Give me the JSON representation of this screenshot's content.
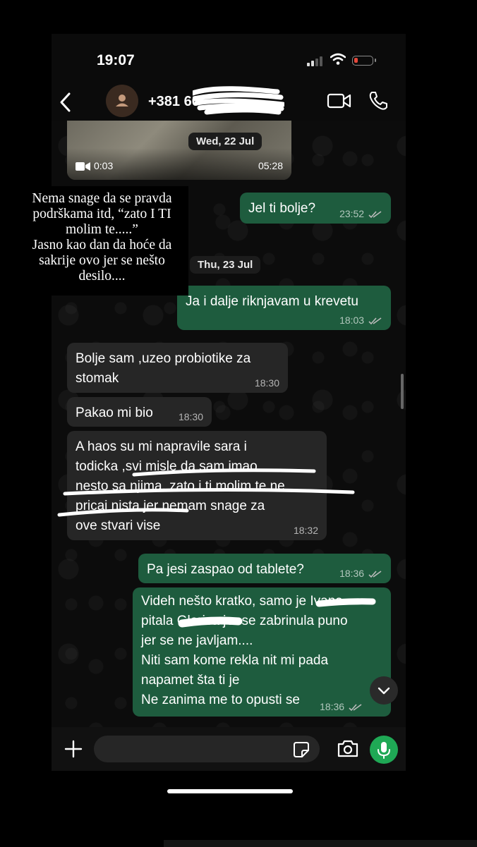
{
  "status_bar": {
    "time": "19:07"
  },
  "header": {
    "contact": "+381 60"
  },
  "media": {
    "duration": "0:03",
    "time": "05:28"
  },
  "dates": {
    "d1": "Wed, 22 Jul",
    "d2": "Thu, 23 Jul"
  },
  "annotation": {
    "lines": [
      "Nema snage da se pravda",
      "podrškama itd, “zato I TI",
      "molim te.....”",
      "Jasno kao dan da hoće da",
      "sakrije ovo jer se nešto",
      "desilo...."
    ]
  },
  "messages": [
    {
      "dir": "out",
      "text": "Jel ti bolje?",
      "time": "23:52"
    },
    {
      "dir": "out",
      "text": "Ja i dalje riknjavam u krevetu",
      "time": "18:03"
    },
    {
      "dir": "in",
      "lines": [
        "Bolje sam ,uzeo probiotike za",
        "stomak"
      ],
      "time": "18:30"
    },
    {
      "dir": "in",
      "text": "Pakao mi bio",
      "time": "18:30"
    },
    {
      "dir": "in",
      "lines": [
        "A haos su mi napravile sara i",
        "todicka ,svi misle da sam imao",
        "nesto sa njima, zato i ti molim te ne",
        "pricaj nista jer nemam snage za",
        "ove stvari vise"
      ],
      "time": "18:32"
    },
    {
      "dir": "out",
      "text": "Pa jesi zaspao od tablete?",
      "time": "18:36"
    },
    {
      "dir": "out",
      "lines": [
        "Videh nešto kratko, samo je Ivana",
        "pitala Glorica jer se zabrinula puno",
        "jer se ne javljam....",
        "Niti sam kome rekla nit mi pada",
        "napamet šta ti je",
        "Ne zanima me to opusti se"
      ],
      "time": "18:36"
    }
  ]
}
